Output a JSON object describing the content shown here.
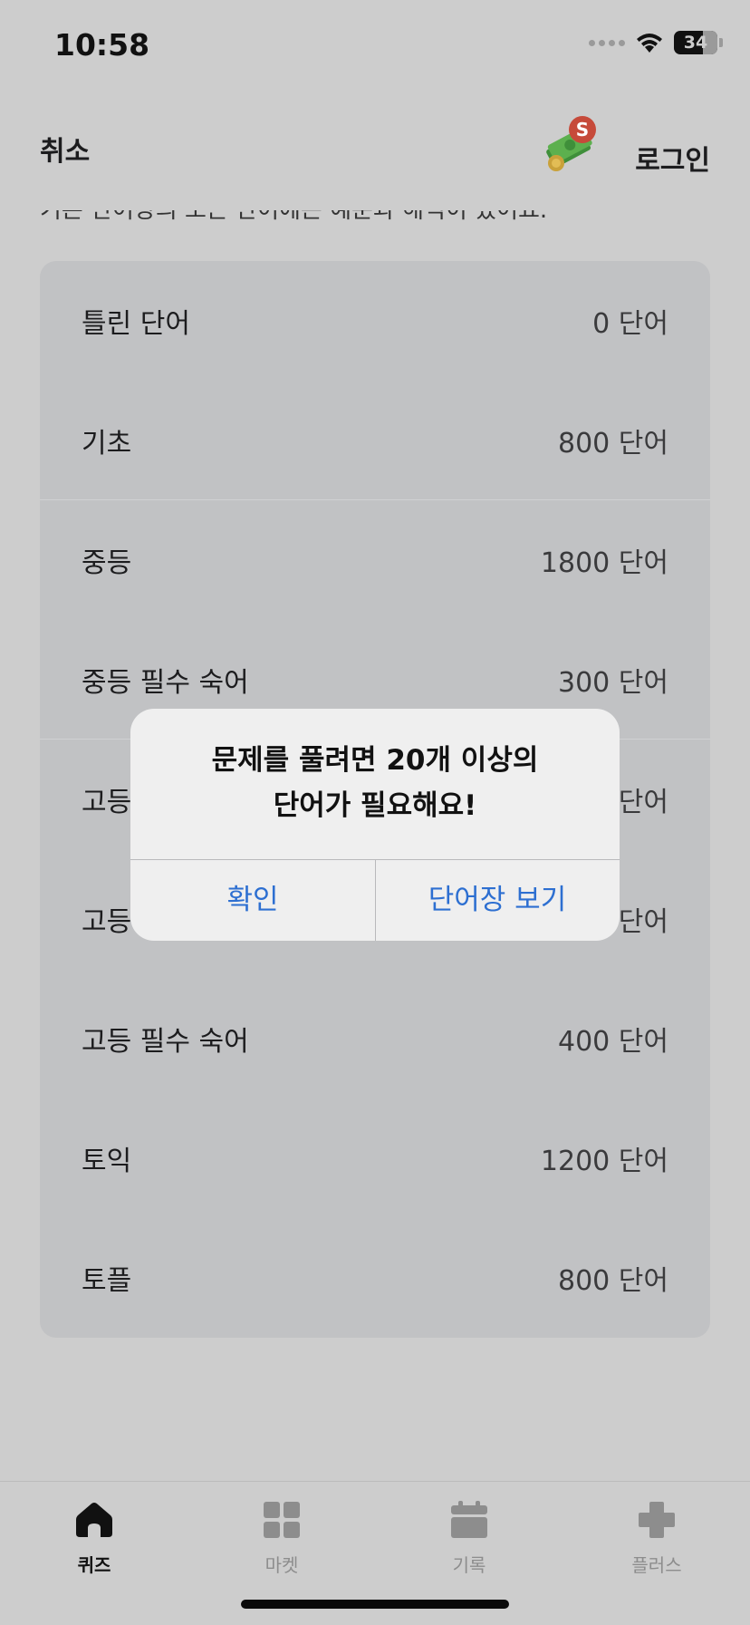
{
  "status_bar": {
    "time": "10:58",
    "battery": "34"
  },
  "nav": {
    "cancel_label": "취소",
    "badge": "S",
    "login_label": "로그인",
    "money_icon": "money-bag-icon"
  },
  "description": "기본 단어장의 모든 단어에는 예문과 해석이 있어요.",
  "word_sets": [
    {
      "name": "틀린 단어",
      "count": "0 단어"
    },
    {
      "name": "기초",
      "count": "800 단어"
    },
    {
      "name": "중등",
      "count": "1800 단어"
    },
    {
      "name": "중등 필수 숙어",
      "count": "300 단어"
    },
    {
      "name": "고등",
      "count": "단어"
    },
    {
      "name": "고등",
      "count": "단어"
    },
    {
      "name": "고등 필수 숙어",
      "count": "400 단어"
    },
    {
      "name": "토익",
      "count": "1200 단어"
    },
    {
      "name": "토플",
      "count": "800 단어"
    }
  ],
  "alert": {
    "title_line1": "문제를 풀려면 20개 이상의",
    "title_line2": "단어가 필요해요!",
    "confirm_label": "확인",
    "view_label": "단어장 보기"
  },
  "tabs": [
    {
      "label": "퀴즈",
      "icon": "home-icon",
      "active": true
    },
    {
      "label": "마켓",
      "icon": "grid-icon",
      "active": false
    },
    {
      "label": "기록",
      "icon": "calendar-icon",
      "active": false
    },
    {
      "label": "플러스",
      "icon": "plus-icon",
      "active": false
    }
  ],
  "colors": {
    "accent": "#2d6fd1",
    "background": "#cdcdcd",
    "card": "#c1c2c4",
    "badge": "#c64a3a"
  }
}
